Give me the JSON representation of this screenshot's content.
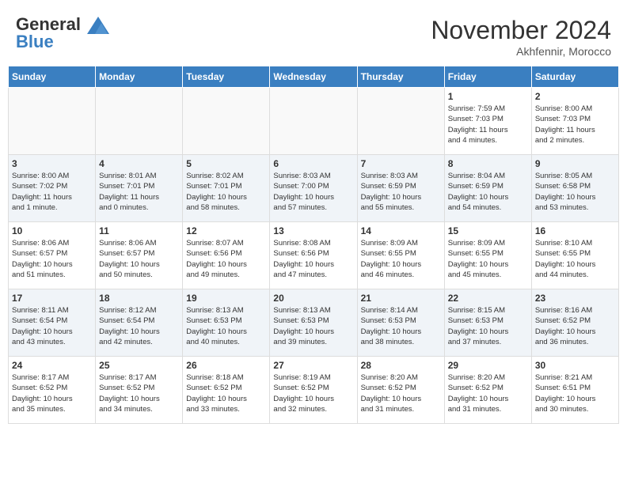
{
  "header": {
    "logo_general": "General",
    "logo_blue": "Blue",
    "month_title": "November 2024",
    "subtitle": "Akhfennir, Morocco"
  },
  "weekdays": [
    "Sunday",
    "Monday",
    "Tuesday",
    "Wednesday",
    "Thursday",
    "Friday",
    "Saturday"
  ],
  "weeks": [
    {
      "stripe": false,
      "days": [
        {
          "num": "",
          "info": ""
        },
        {
          "num": "",
          "info": ""
        },
        {
          "num": "",
          "info": ""
        },
        {
          "num": "",
          "info": ""
        },
        {
          "num": "",
          "info": ""
        },
        {
          "num": "1",
          "info": "Sunrise: 7:59 AM\nSunset: 7:03 PM\nDaylight: 11 hours\nand 4 minutes."
        },
        {
          "num": "2",
          "info": "Sunrise: 8:00 AM\nSunset: 7:03 PM\nDaylight: 11 hours\nand 2 minutes."
        }
      ]
    },
    {
      "stripe": true,
      "days": [
        {
          "num": "3",
          "info": "Sunrise: 8:00 AM\nSunset: 7:02 PM\nDaylight: 11 hours\nand 1 minute."
        },
        {
          "num": "4",
          "info": "Sunrise: 8:01 AM\nSunset: 7:01 PM\nDaylight: 11 hours\nand 0 minutes."
        },
        {
          "num": "5",
          "info": "Sunrise: 8:02 AM\nSunset: 7:01 PM\nDaylight: 10 hours\nand 58 minutes."
        },
        {
          "num": "6",
          "info": "Sunrise: 8:03 AM\nSunset: 7:00 PM\nDaylight: 10 hours\nand 57 minutes."
        },
        {
          "num": "7",
          "info": "Sunrise: 8:03 AM\nSunset: 6:59 PM\nDaylight: 10 hours\nand 55 minutes."
        },
        {
          "num": "8",
          "info": "Sunrise: 8:04 AM\nSunset: 6:59 PM\nDaylight: 10 hours\nand 54 minutes."
        },
        {
          "num": "9",
          "info": "Sunrise: 8:05 AM\nSunset: 6:58 PM\nDaylight: 10 hours\nand 53 minutes."
        }
      ]
    },
    {
      "stripe": false,
      "days": [
        {
          "num": "10",
          "info": "Sunrise: 8:06 AM\nSunset: 6:57 PM\nDaylight: 10 hours\nand 51 minutes."
        },
        {
          "num": "11",
          "info": "Sunrise: 8:06 AM\nSunset: 6:57 PM\nDaylight: 10 hours\nand 50 minutes."
        },
        {
          "num": "12",
          "info": "Sunrise: 8:07 AM\nSunset: 6:56 PM\nDaylight: 10 hours\nand 49 minutes."
        },
        {
          "num": "13",
          "info": "Sunrise: 8:08 AM\nSunset: 6:56 PM\nDaylight: 10 hours\nand 47 minutes."
        },
        {
          "num": "14",
          "info": "Sunrise: 8:09 AM\nSunset: 6:55 PM\nDaylight: 10 hours\nand 46 minutes."
        },
        {
          "num": "15",
          "info": "Sunrise: 8:09 AM\nSunset: 6:55 PM\nDaylight: 10 hours\nand 45 minutes."
        },
        {
          "num": "16",
          "info": "Sunrise: 8:10 AM\nSunset: 6:55 PM\nDaylight: 10 hours\nand 44 minutes."
        }
      ]
    },
    {
      "stripe": true,
      "days": [
        {
          "num": "17",
          "info": "Sunrise: 8:11 AM\nSunset: 6:54 PM\nDaylight: 10 hours\nand 43 minutes."
        },
        {
          "num": "18",
          "info": "Sunrise: 8:12 AM\nSunset: 6:54 PM\nDaylight: 10 hours\nand 42 minutes."
        },
        {
          "num": "19",
          "info": "Sunrise: 8:13 AM\nSunset: 6:53 PM\nDaylight: 10 hours\nand 40 minutes."
        },
        {
          "num": "20",
          "info": "Sunrise: 8:13 AM\nSunset: 6:53 PM\nDaylight: 10 hours\nand 39 minutes."
        },
        {
          "num": "21",
          "info": "Sunrise: 8:14 AM\nSunset: 6:53 PM\nDaylight: 10 hours\nand 38 minutes."
        },
        {
          "num": "22",
          "info": "Sunrise: 8:15 AM\nSunset: 6:53 PM\nDaylight: 10 hours\nand 37 minutes."
        },
        {
          "num": "23",
          "info": "Sunrise: 8:16 AM\nSunset: 6:52 PM\nDaylight: 10 hours\nand 36 minutes."
        }
      ]
    },
    {
      "stripe": false,
      "days": [
        {
          "num": "24",
          "info": "Sunrise: 8:17 AM\nSunset: 6:52 PM\nDaylight: 10 hours\nand 35 minutes."
        },
        {
          "num": "25",
          "info": "Sunrise: 8:17 AM\nSunset: 6:52 PM\nDaylight: 10 hours\nand 34 minutes."
        },
        {
          "num": "26",
          "info": "Sunrise: 8:18 AM\nSunset: 6:52 PM\nDaylight: 10 hours\nand 33 minutes."
        },
        {
          "num": "27",
          "info": "Sunrise: 8:19 AM\nSunset: 6:52 PM\nDaylight: 10 hours\nand 32 minutes."
        },
        {
          "num": "28",
          "info": "Sunrise: 8:20 AM\nSunset: 6:52 PM\nDaylight: 10 hours\nand 31 minutes."
        },
        {
          "num": "29",
          "info": "Sunrise: 8:20 AM\nSunset: 6:52 PM\nDaylight: 10 hours\nand 31 minutes."
        },
        {
          "num": "30",
          "info": "Sunrise: 8:21 AM\nSunset: 6:51 PM\nDaylight: 10 hours\nand 30 minutes."
        }
      ]
    }
  ]
}
